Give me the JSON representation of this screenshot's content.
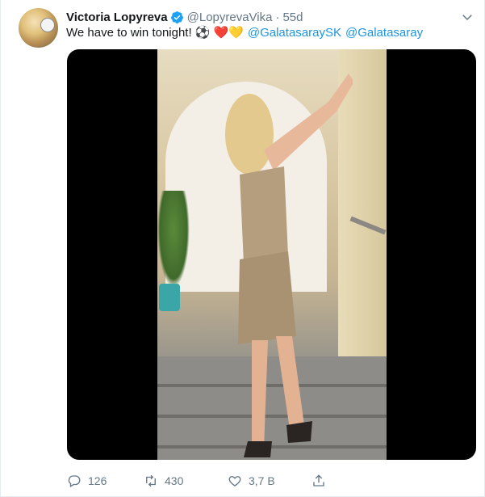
{
  "tweet": {
    "author_name": "Victoria Lopyreva",
    "handle": "@LopyrevaVika",
    "separator": "·",
    "time": "55d",
    "text": "We have to win tonight!",
    "emojis": "⚽ ❤️💛",
    "mentions": [
      "@GalatasaraySK",
      "@Galatasaray"
    ]
  },
  "stats": {
    "replies": "126",
    "retweets": "430",
    "likes": "3,7 B"
  },
  "colors": {
    "link": "#1b95e0",
    "verified": "#1da1f2",
    "secondary_text": "#657786"
  },
  "icons": {
    "verified": "verified-badge-icon",
    "menu": "chevron-down-icon",
    "reply": "reply-icon",
    "retweet": "retweet-icon",
    "like": "heart-icon",
    "share": "share-icon"
  }
}
